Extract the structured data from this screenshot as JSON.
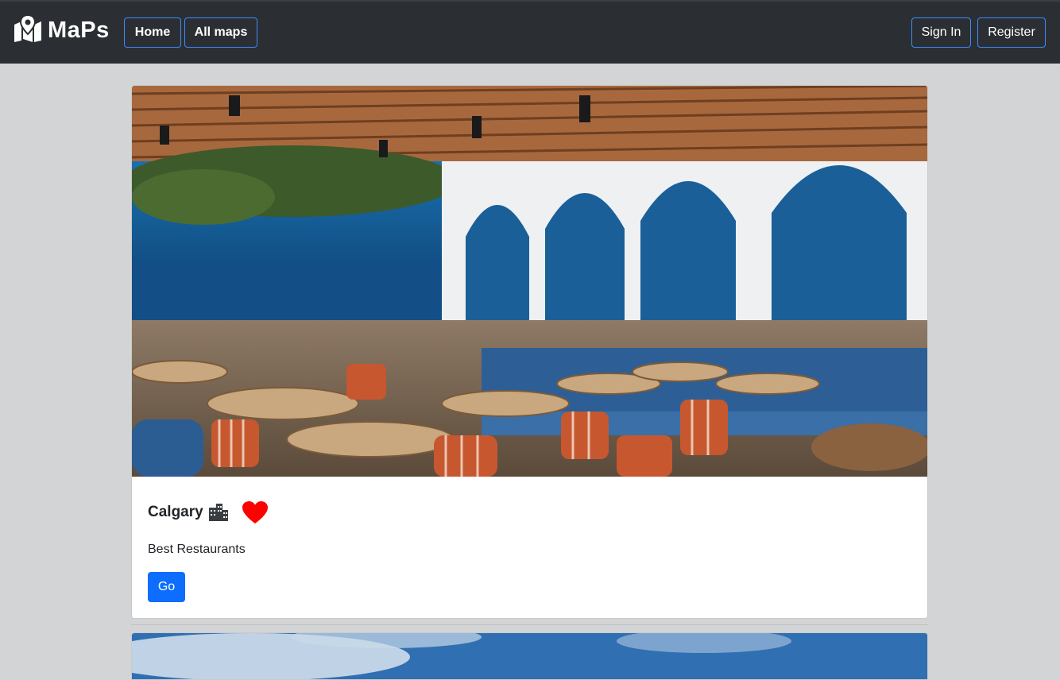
{
  "navbar": {
    "brand": "MaPs",
    "brand_icon": "map-marker-icon",
    "links": [
      {
        "label": "Home"
      },
      {
        "label": "All maps"
      }
    ],
    "auth": {
      "sign_in": "Sign In",
      "register": "Register"
    }
  },
  "cards": [
    {
      "title": "Calgary",
      "title_icon": "city-buildings-icon",
      "favorite_icon": "heart-icon",
      "favorite_color": "#ff0000",
      "description": "Best Restaurants",
      "button_label": "Go",
      "image_alt": "restaurant interior photo"
    }
  ],
  "colors": {
    "navbar_bg": "#2b2f34",
    "page_bg": "#d3d4d5",
    "nav_button_border": "#3d8bfd",
    "primary_button": "#0d6efd"
  }
}
